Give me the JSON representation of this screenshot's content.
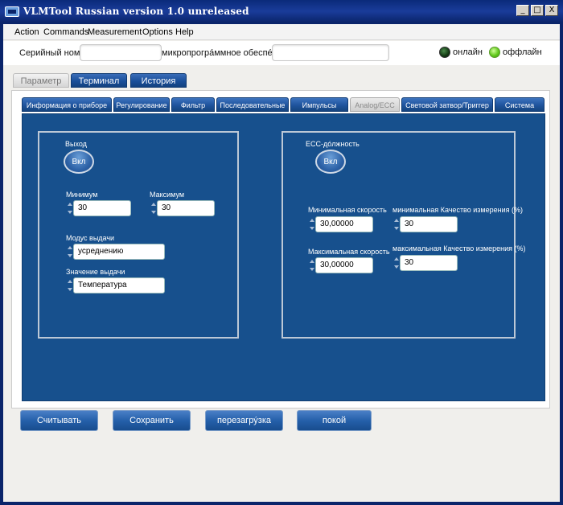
{
  "window": {
    "title": "VLMTool  Russian version 1.0 unreleased",
    "controls": {
      "minimize": "_",
      "maximize": "□",
      "close": "X"
    }
  },
  "menu": [
    "Action",
    "Commands",
    "Measurement",
    "Options",
    "Help"
  ],
  "toolbar": {
    "serial_label": "Серийный номер",
    "serial_value": "",
    "firmware_label": "микропрогрáммное обеспéчение",
    "firmware_value": "",
    "online_label": "онлайн",
    "offline_label": "оффлайн",
    "colors": {
      "online_led": "#123812",
      "offline_led": "#62c91c"
    }
  },
  "main_tabs": [
    {
      "label": "Параметр",
      "active": true
    },
    {
      "label": "Терминал",
      "active": false
    },
    {
      "label": "История",
      "active": false
    }
  ],
  "sub_tabs": [
    {
      "label": "Информация о приборе",
      "active": false
    },
    {
      "label": "Регулирование",
      "active": false
    },
    {
      "label": "Фильтр",
      "active": false
    },
    {
      "label": "Последовательные",
      "active": false
    },
    {
      "label": "Импульсы",
      "active": false
    },
    {
      "label": "Analog/ECC",
      "active": true
    },
    {
      "label": "Световой затвор/Триггер",
      "active": false
    },
    {
      "label": "Система",
      "active": false
    }
  ],
  "output_group": {
    "output_label": "Выход",
    "output_button": "Вкл",
    "min_label": "Минимум",
    "min_value": "30",
    "max_label": "Максимум",
    "max_value": "30",
    "mode_label": "Модус выдачи",
    "mode_value": "усреднению",
    "value_label": "Значение выдачи",
    "value_value": "Температура"
  },
  "ecc_group": {
    "ecc_label": "ECC-дóлжность",
    "ecc_button": "Вкл",
    "min_speed_label": "Минимальная скорость",
    "min_speed_value": "30,00000",
    "min_quality_label": "минимальная Качество измерения (%)",
    "min_quality_value": "30",
    "max_speed_label": "Максимальная скорость",
    "max_speed_value": "30,00000",
    "max_quality_label": "максимальная Качество измерения (%)",
    "max_quality_value": "30"
  },
  "actions": {
    "read": "Считывать",
    "save": "Сохранить",
    "reboot": "перезагрýзка",
    "rest": "покой"
  },
  "colors": {
    "accent": "#17508d",
    "title_bar": "#0a246a"
  }
}
